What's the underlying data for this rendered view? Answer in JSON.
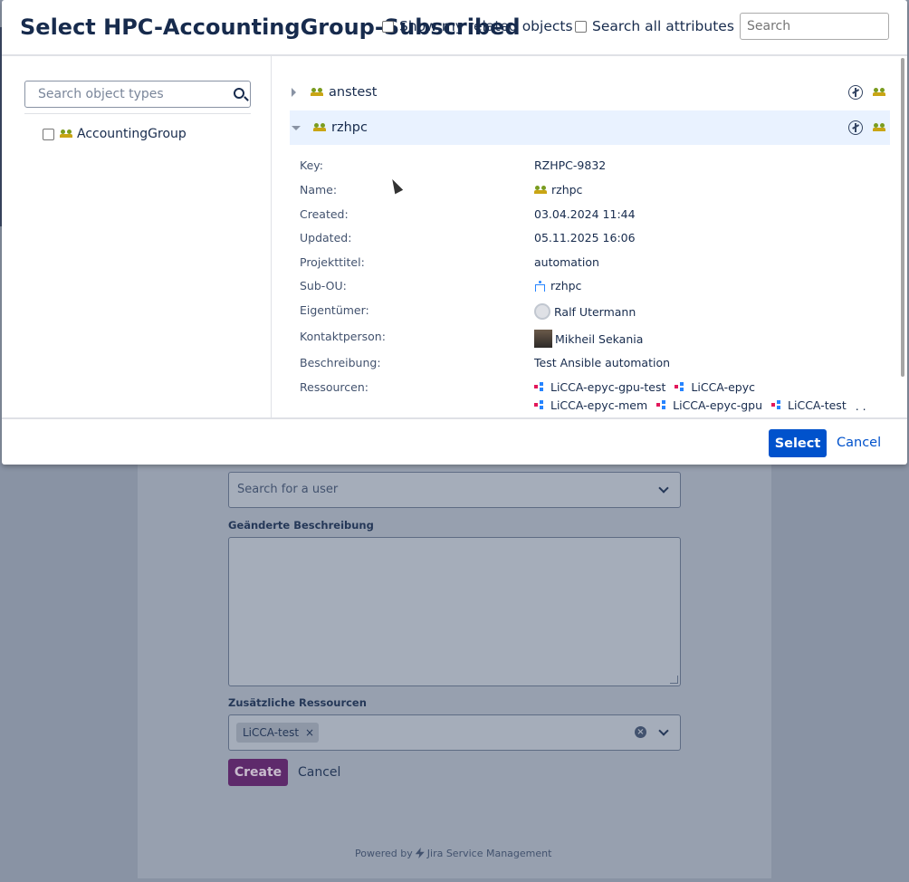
{
  "background": {
    "user_placeholder": "Search for a user",
    "changed_description_label": "Geänderte Beschreibung",
    "additional_resources_label": "Zusätzliche Ressourcen",
    "tag": "LiCCA-test",
    "create_label": "Create",
    "cancel_label": "Cancel",
    "powered_prefix": "Powered by",
    "powered_product": "Jira Service Management"
  },
  "modal": {
    "title": "Select HPC-AccountingGroup-Subscribed",
    "show_related_label": "Show my related objects",
    "search_all_label": "Search all attributes",
    "search_placeholder": "Search",
    "type_search_placeholder": "Search object types",
    "object_types": [
      {
        "label": "AccountingGroup",
        "icon": "group-icon"
      }
    ],
    "objects": [
      {
        "name": "anstest",
        "expanded": false
      },
      {
        "name": "rzhpc",
        "expanded": true
      }
    ],
    "attributes": [
      {
        "key": "Key:",
        "value": "RZHPC-9832"
      },
      {
        "key": "Name:",
        "value": "rzhpc",
        "icon": "group-icon"
      },
      {
        "key": "Created:",
        "value": "03.04.2024 11:44"
      },
      {
        "key": "Updated:",
        "value": "05.11.2025 16:06"
      },
      {
        "key": "Projekttitel:",
        "value": "automation"
      },
      {
        "key": "Sub-OU:",
        "value": "rzhpc",
        "icon": "org-unit-icon"
      },
      {
        "key": "Eigentümer:",
        "value": "Ralf Utermann",
        "icon": "avatar-default"
      },
      {
        "key": "Kontaktperson:",
        "value": "Mikheil Sekania",
        "icon": "avatar-photo"
      },
      {
        "key": "Beschreibung:",
        "value": "Test Ansible automation"
      },
      {
        "key": "Ressourcen:",
        "values": [
          "LiCCA-epyc-gpu-test",
          "LiCCA-epyc",
          "LiCCA-epyc-mem",
          "LiCCA-epyc-gpu",
          "LiCCA-test"
        ],
        "more": ". . ."
      }
    ],
    "select_label": "Select",
    "cancel_label": "Cancel"
  }
}
